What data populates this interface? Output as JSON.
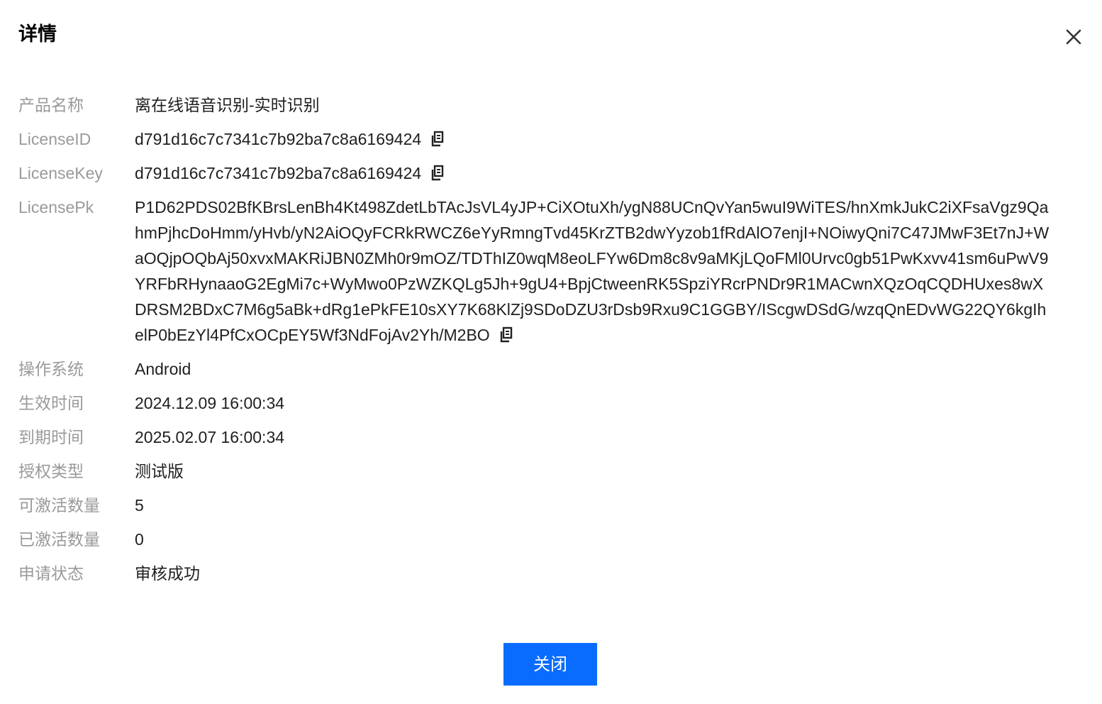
{
  "dialog": {
    "title": "详情",
    "close_button": "关闭"
  },
  "details": {
    "product_name": {
      "label": "产品名称",
      "value": "离在线语音识别-实时识别"
    },
    "license_id": {
      "label": "LicenseID",
      "value": "d791d16c7c7341c7b92ba7c8a6169424"
    },
    "license_key": {
      "label": "LicenseKey",
      "value": "d791d16c7c7341c7b92ba7c8a6169424"
    },
    "license_pk": {
      "label": "LicensePk",
      "value": "P1D62PDS02BfKBrsLenBh4Kt498ZdetLbTAcJsVL4yJP+CiXOtuXh/ygN88UCnQvYan5wuI9WiTES/hnXmkJukC2iXFsaVgz9QahmPjhcDoHmm/yHvb/yN2AiOQyFCRkRWCZ6eYyRmngTvd45KrZTB2dwYyzob1fRdAlO7enjI+NOiwyQni7C47JMwF3Et7nJ+WaOQjpOQbAj50xvxMAKRiJBN0ZMh0r9mOZ/TDThIZ0wqM8eoLFYw6Dm8c8v9aMKjLQoFMl0Urvc0gb51PwKxvv41sm6uPwV9YRFbRHynaaoG2EgMi7c+WyMwo0PzWZKQLg5Jh+9gU4+BpjCtweenRK5SpziYRcrPNDr9R1MACwnXQzOqCQDHUxes8wXDRSM2BDxC7M6g5aBk+dRg1ePkFE10sXY7K68KlZj9SDoDZU3rDsb9Rxu9C1GGBY/IScgwDSdG/wzqQnEDvWG22QY6kgIhelP0bEzYl4PfCxOCpEY5Wf3NdFojAv2Yh/M2BO"
    },
    "os": {
      "label": "操作系统",
      "value": "Android"
    },
    "effective_time": {
      "label": "生效时间",
      "value": "2024.12.09 16:00:34"
    },
    "expire_time": {
      "label": "到期时间",
      "value": "2025.02.07 16:00:34"
    },
    "license_type": {
      "label": "授权类型",
      "value": "测试版"
    },
    "activatable_count": {
      "label": "可激活数量",
      "value": "5"
    },
    "activated_count": {
      "label": "已激活数量",
      "value": "0"
    },
    "apply_status": {
      "label": "申请状态",
      "value": "审核成功"
    }
  },
  "icons": {
    "close": "close-icon",
    "copy": "copy-icon"
  },
  "colors": {
    "primary_button": "#0a6cff",
    "label_text": "#9a9a9a",
    "value_text": "#1f1f1f"
  }
}
